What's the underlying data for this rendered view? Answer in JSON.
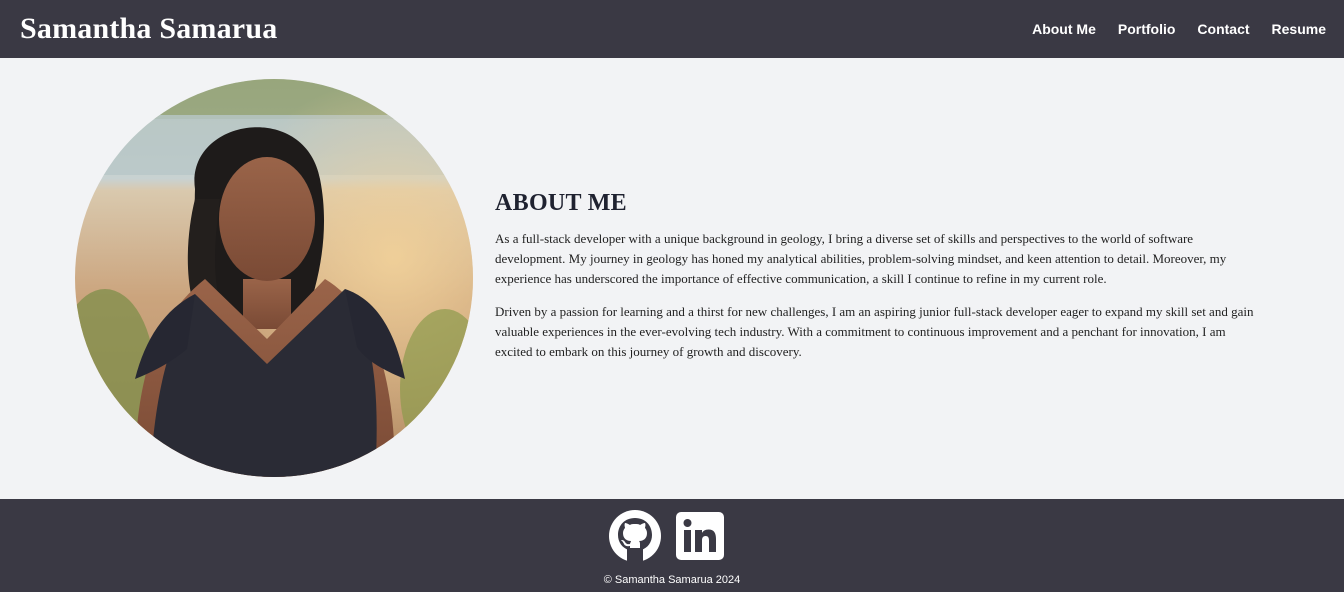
{
  "header": {
    "site_title": "Samantha Samarua",
    "nav": [
      "About Me",
      "Portfolio",
      "Contact",
      "Resume"
    ]
  },
  "about": {
    "heading": "ABOUT ME",
    "paragraphs": [
      "As a full-stack developer with a unique background in geology, I bring a diverse set of skills and perspectives to the world of software development. My journey in geology has honed my analytical abilities, problem-solving mindset, and keen attention to detail. Moreover, my experience has underscored the importance of effective communication, a skill I continue to refine in my current role.",
      "Driven by a passion for learning and a thirst for new challenges, I am an aspiring junior full-stack developer eager to expand my skill set and gain valuable experiences in the ever-evolving tech industry. With a commitment to continuous improvement and a penchant for innovation, I am excited to embark on this journey of growth and discovery."
    ]
  },
  "footer": {
    "social_icons": [
      "github-icon",
      "linkedin-icon"
    ],
    "copyright": "© Samantha Samarua 2024"
  },
  "colors": {
    "bar_background": "#3a3944",
    "page_background": "#f2f3f5"
  }
}
